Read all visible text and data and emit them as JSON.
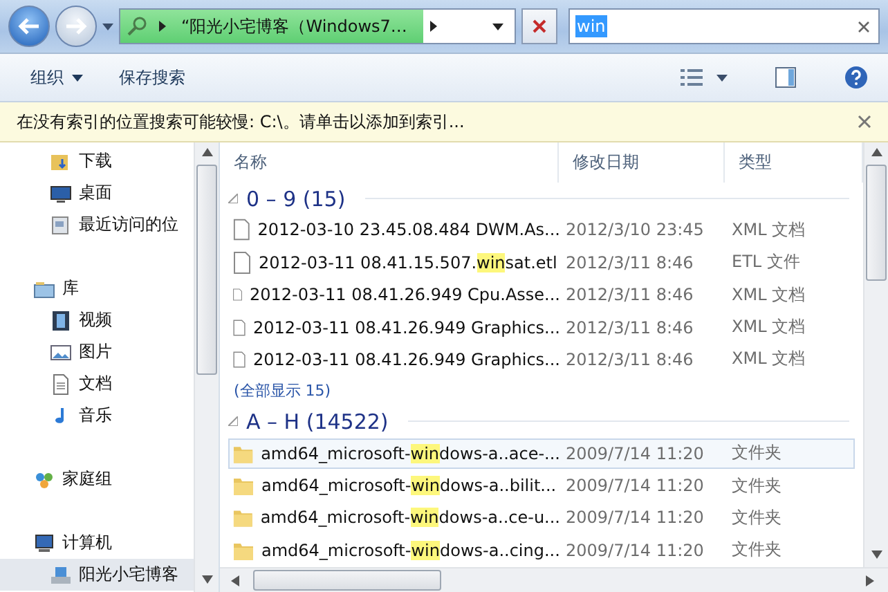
{
  "address_bar": {
    "path": "“阳光小宅博客（Windows7…",
    "level": 0.77
  },
  "search": {
    "value": "win"
  },
  "toolbar": {
    "buttons": [
      {
        "label": "组织",
        "dropdown": true
      },
      {
        "label": "保存搜索",
        "dropdown": false
      }
    ]
  },
  "info_bar": {
    "text": "在没有索引的位置搜索可能较慢: C:\\。请单击以添加到索引..."
  },
  "sidebar": {
    "items": [
      {
        "label": "下载",
        "kind": "download",
        "group": false,
        "selected": false
      },
      {
        "label": "桌面",
        "kind": "desktop",
        "group": false,
        "selected": false
      },
      {
        "label": "最近访问的位",
        "kind": "recent",
        "group": false,
        "selected": false
      },
      {
        "label": "库",
        "kind": "library",
        "group": true,
        "selected": false
      },
      {
        "label": "视频",
        "kind": "video",
        "group": false,
        "selected": false
      },
      {
        "label": "图片",
        "kind": "picture",
        "group": false,
        "selected": false
      },
      {
        "label": "文档",
        "kind": "document",
        "group": false,
        "selected": false
      },
      {
        "label": "音乐",
        "kind": "music",
        "group": false,
        "selected": false
      },
      {
        "label": "家庭组",
        "kind": "homegroup",
        "group": true,
        "selected": false
      },
      {
        "label": "计算机",
        "kind": "computer",
        "group": true,
        "selected": false
      },
      {
        "label": "阳光小宅博客",
        "kind": "drive",
        "group": false,
        "selected": true
      }
    ]
  },
  "table": {
    "columns": [
      "名称",
      "修改日期",
      "类型"
    ],
    "groups": [
      {
        "title": "0 – 9 (15)",
        "rows": [
          {
            "kind": "file",
            "name": [
              "2012-03-10 23.45.08.484 DWM.As..."
            ],
            "date": "2012/3/10 23:45",
            "type": "XML 文档",
            "selected": false
          },
          {
            "kind": "file",
            "name": [
              "2012-03-11 08.41.15.507.",
              "win",
              "sat.etl"
            ],
            "date": "2012/3/11 8:46",
            "type": "ETL 文件",
            "selected": false
          },
          {
            "kind": "file",
            "name": [
              "2012-03-11 08.41.26.949 Cpu.Asse..."
            ],
            "date": "2012/3/11 8:46",
            "type": "XML 文档",
            "selected": false
          },
          {
            "kind": "file",
            "name": [
              "2012-03-11 08.41.26.949 Graphics..."
            ],
            "date": "2012/3/11 8:46",
            "type": "XML 文档",
            "selected": false
          },
          {
            "kind": "file",
            "name": [
              "2012-03-11 08.41.26.949 Graphics..."
            ],
            "date": "2012/3/11 8:46",
            "type": "XML 文档",
            "selected": false
          }
        ],
        "show_all": "(全部显示 15)"
      },
      {
        "title": "A – H (14522)",
        "rows": [
          {
            "kind": "folder",
            "name": [
              "amd64_microsoft-",
              "win",
              "dows-a..ace-..."
            ],
            "date": "2009/7/14 11:20",
            "type": "文件夹",
            "selected": true
          },
          {
            "kind": "folder",
            "name": [
              "amd64_microsoft-",
              "win",
              "dows-a..bilit..."
            ],
            "date": "2009/7/14 11:20",
            "type": "文件夹",
            "selected": false
          },
          {
            "kind": "folder",
            "name": [
              "amd64_microsoft-",
              "win",
              "dows-a..ce-u..."
            ],
            "date": "2009/7/14 11:20",
            "type": "文件夹",
            "selected": false
          },
          {
            "kind": "folder",
            "name": [
              "amd64_microsoft-",
              "win",
              "dows-a..cing..."
            ],
            "date": "2009/7/14 11:20",
            "type": "文件夹",
            "selected": false
          }
        ]
      }
    ]
  }
}
